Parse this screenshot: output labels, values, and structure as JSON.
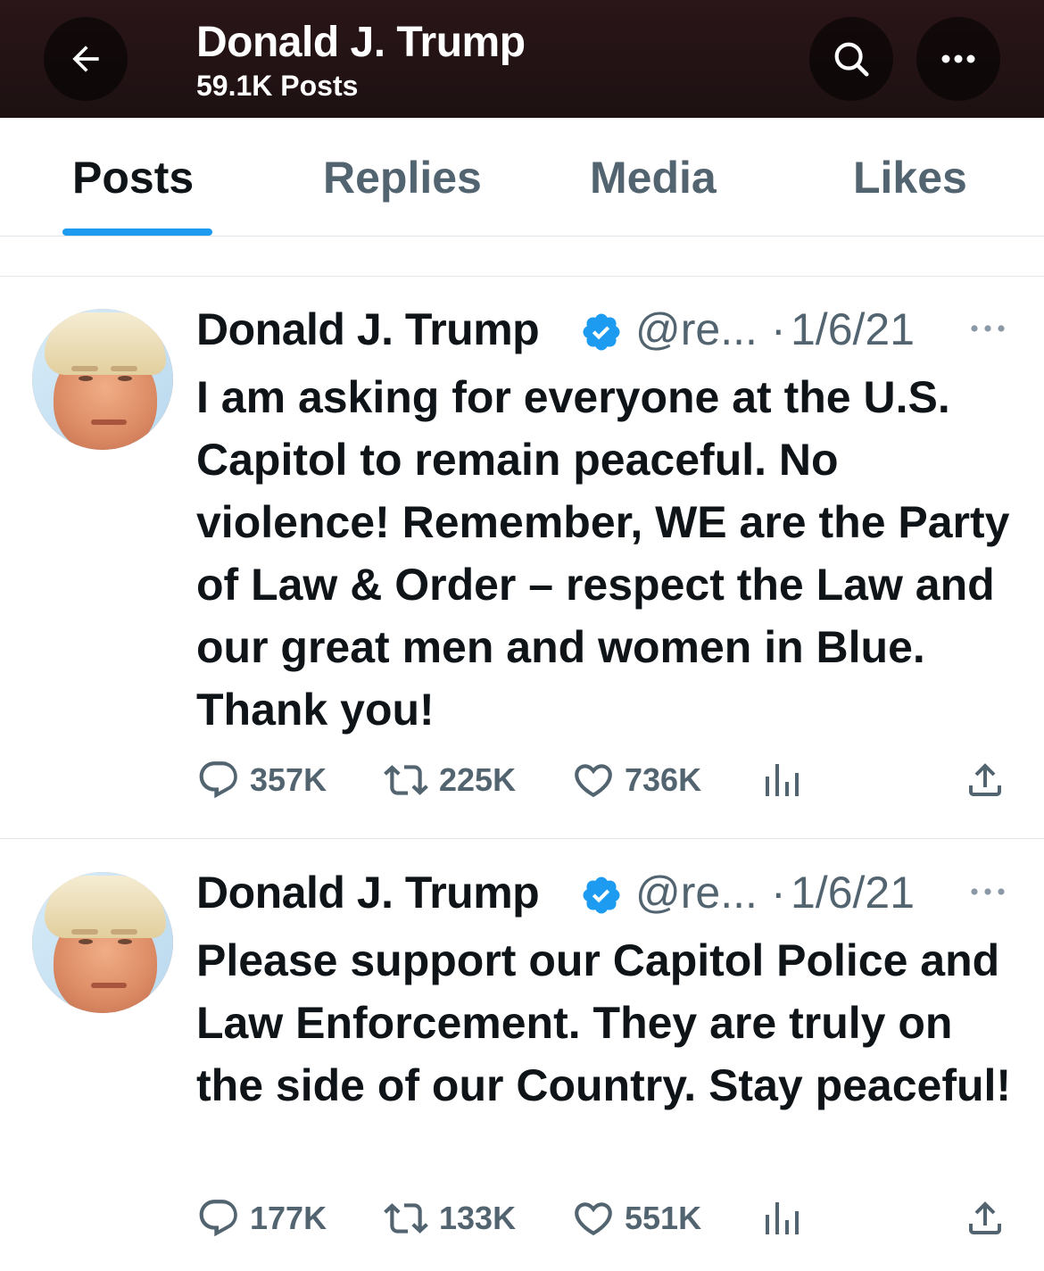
{
  "header": {
    "title": "Donald J. Trump",
    "subtitle": "59.1K Posts"
  },
  "tabs": [
    {
      "label": "Posts",
      "active": true
    },
    {
      "label": "Replies",
      "active": false
    },
    {
      "label": "Media",
      "active": false
    },
    {
      "label": "Likes",
      "active": false
    }
  ],
  "colors": {
    "accent": "#1d9bf0",
    "secondary_text": "#536471",
    "header_bg": "#1d1112"
  },
  "posts": [
    {
      "author": "Donald J. Trump",
      "verified": true,
      "handle": "@re...",
      "separator": "·",
      "date": "1/6/21",
      "text": "I am asking for everyone at the U.S. Capitol to remain peaceful. No violence! Remember, WE are the Party of Law & Order – respect the Law and our great men and women in Blue. Thank you!",
      "replies": "357K",
      "reposts": "225K",
      "likes": "736K"
    },
    {
      "author": "Donald J. Trump",
      "verified": true,
      "handle": "@re...",
      "separator": "·",
      "date": "1/6/21",
      "text": "Please support our Capitol Police and Law Enforcement. They are truly on the side of our Country. Stay peaceful!",
      "replies": "177K",
      "reposts": "133K",
      "likes": "551K"
    }
  ],
  "icons": [
    "back-arrow-icon",
    "search-icon",
    "more-icon",
    "verified-badge-icon",
    "reply-icon",
    "repost-icon",
    "like-icon",
    "views-icon",
    "share-icon"
  ]
}
